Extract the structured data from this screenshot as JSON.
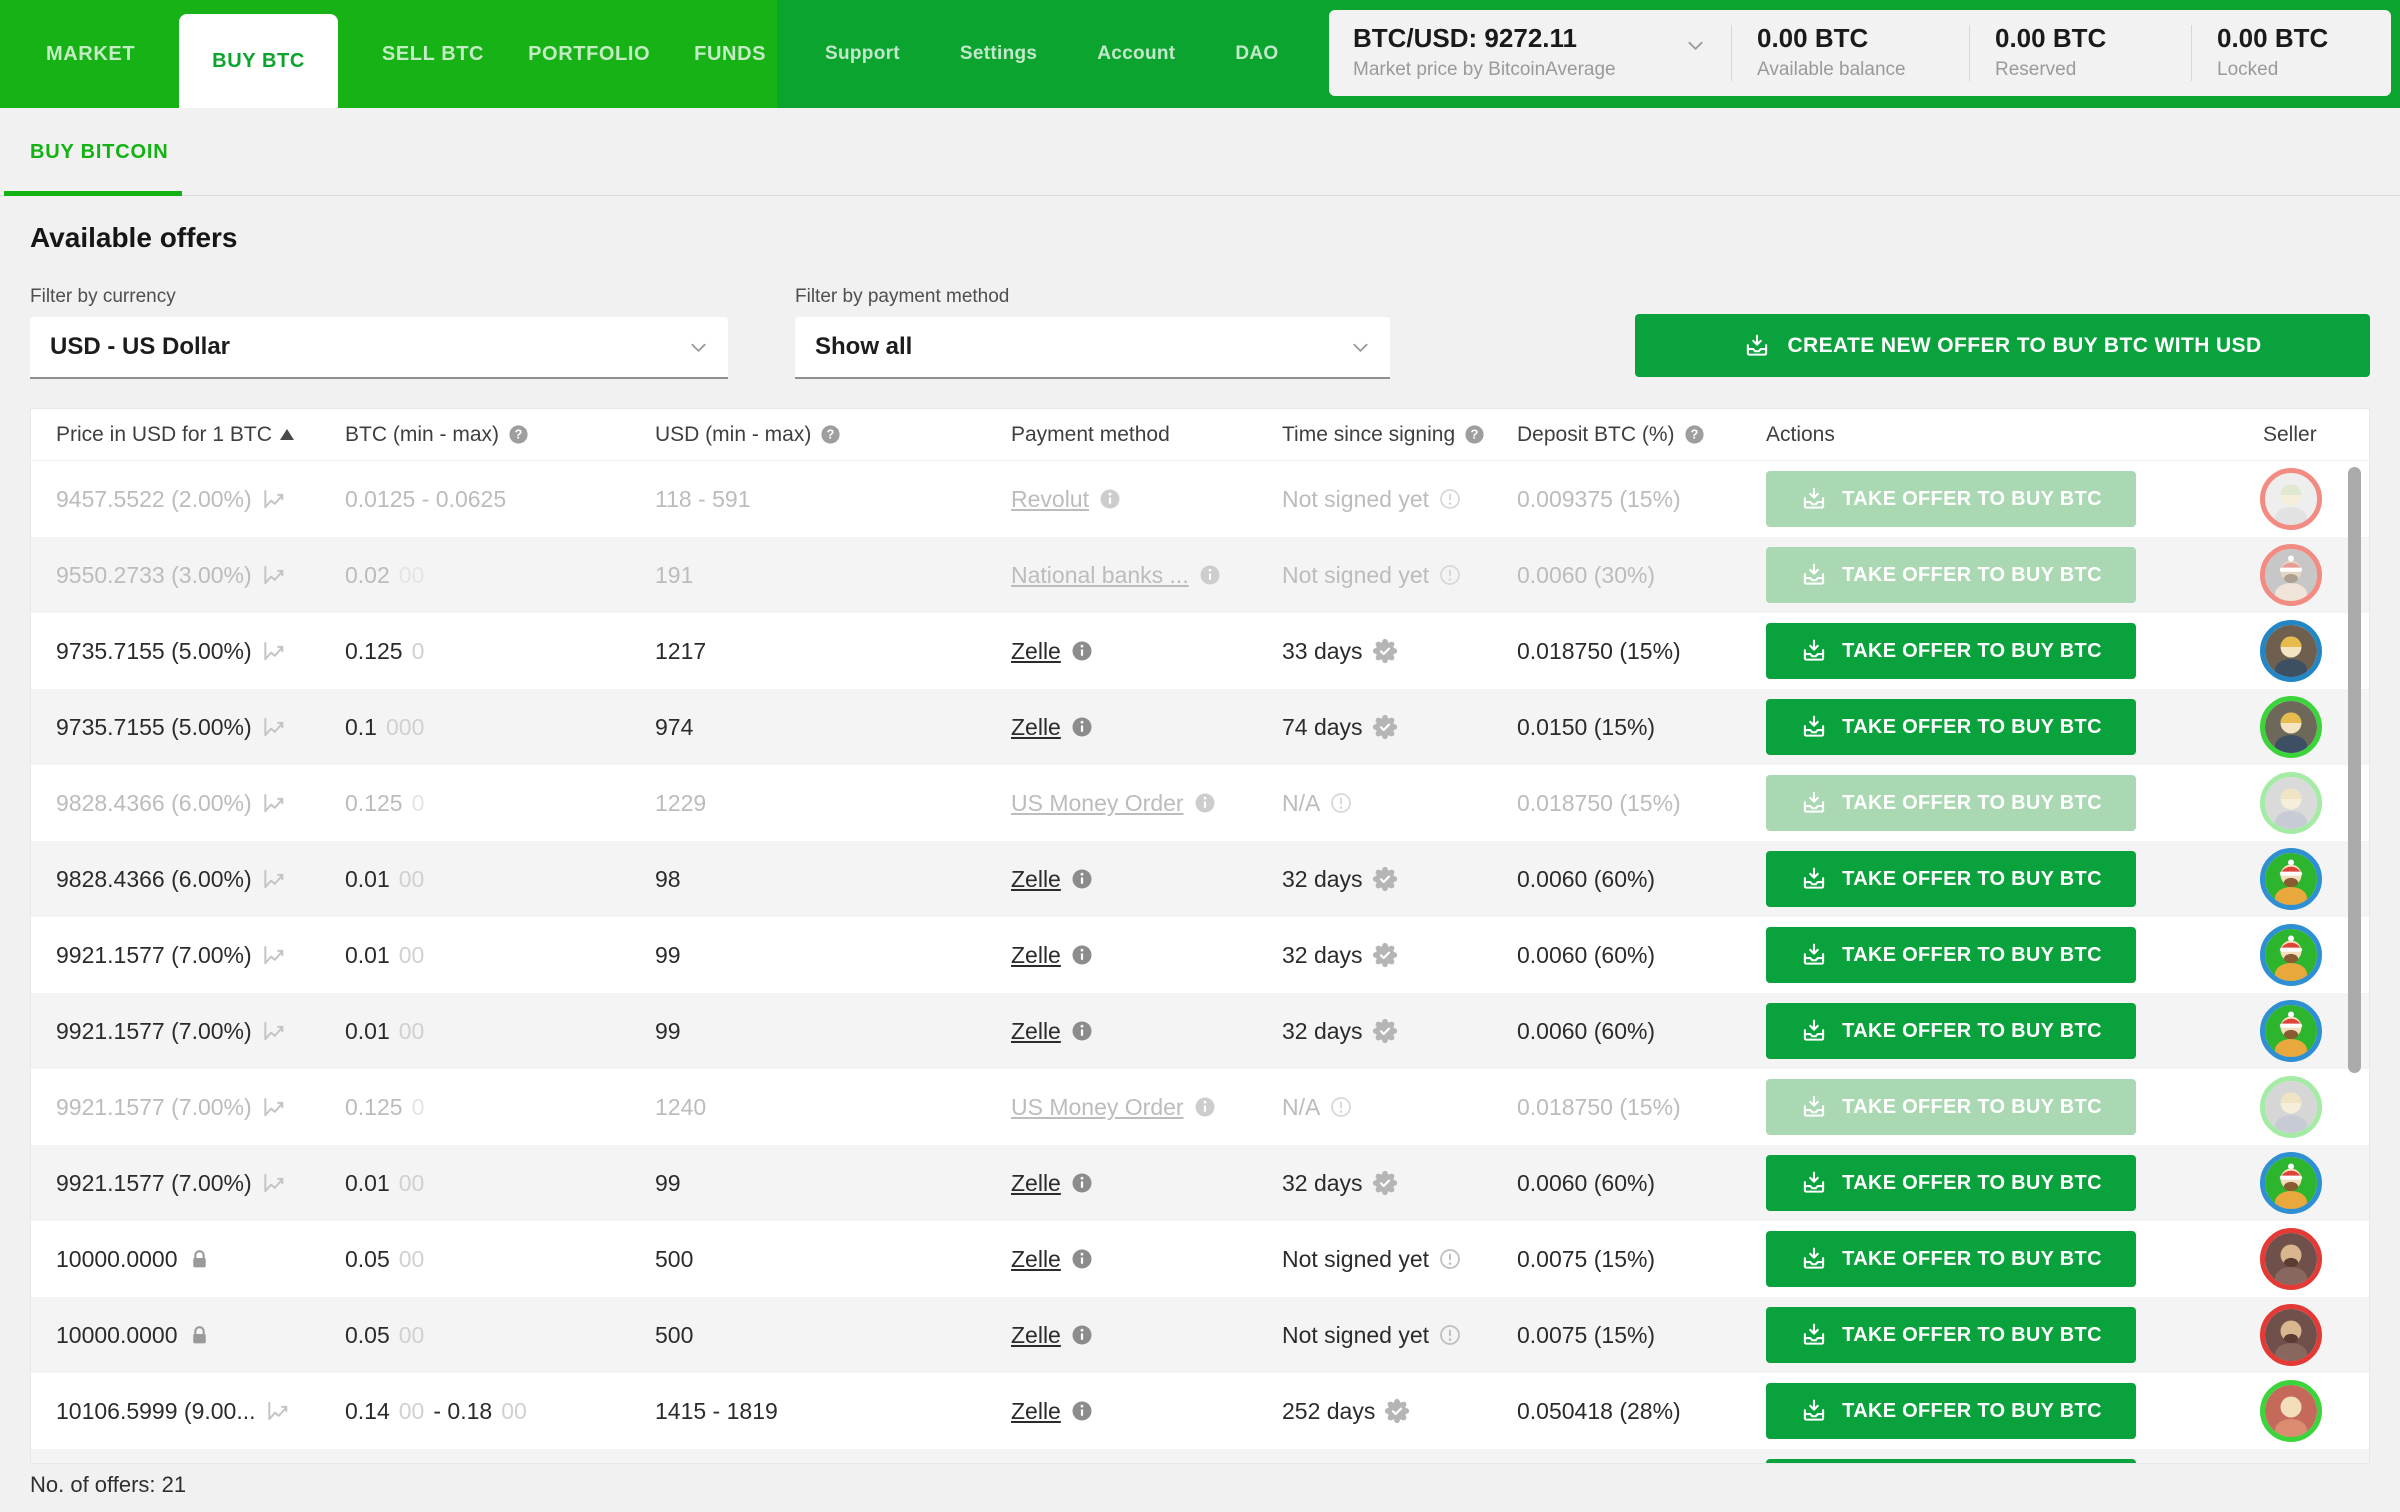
{
  "colors": {
    "nav_left": "#16b216",
    "nav_right": "#0aa42e",
    "accent_green": "#12b212",
    "button_green": "#0aa23c",
    "button_disabled": "#aad8b2",
    "page_bg": "#f1f1f1"
  },
  "nav": {
    "left_items": [
      {
        "label": "MARKET",
        "active": false
      },
      {
        "label": "BUY BTC",
        "active": true
      },
      {
        "label": "SELL BTC",
        "active": false
      },
      {
        "label": "PORTFOLIO",
        "active": false
      },
      {
        "label": "FUNDS",
        "active": false
      }
    ],
    "right_items": [
      "Support",
      "Settings",
      "Account",
      "DAO"
    ]
  },
  "ticker": {
    "pair": "BTC/USD: 9272.11",
    "subtitle": "Market price by BitcoinAverage",
    "balances": [
      {
        "value": "0.00 BTC",
        "label": "Available balance"
      },
      {
        "value": "0.00 BTC",
        "label": "Reserved"
      },
      {
        "value": "0.00 BTC",
        "label": "Locked"
      }
    ]
  },
  "subtab": {
    "label": "BUY BITCOIN"
  },
  "main": {
    "title": "Available offers",
    "currency_filter": {
      "label": "Filter by currency",
      "value": "USD  -  US Dollar"
    },
    "payment_filter": {
      "label": "Filter by payment method",
      "value": "Show all"
    },
    "create_button": "CREATE NEW OFFER TO BUY BTC WITH USD",
    "footer": "No. of offers: 21"
  },
  "table": {
    "headers": {
      "price": "Price in USD for 1 BTC",
      "btc": "BTC (min - max)",
      "usd": "USD (min - max)",
      "payment": "Payment method",
      "time": "Time since signing",
      "deposit": "Deposit BTC (%)",
      "actions": "Actions",
      "seller": "Seller"
    },
    "take_offer_label": "TAKE OFFER TO BUY BTC",
    "icon_names": {
      "chart": "price-chart-icon",
      "lock": "fixed-price-lock-icon",
      "signed": "signed-badge-icon",
      "unsigned": "not-signed-alert-icon",
      "info": "info-icon",
      "question": "help-icon",
      "tray": "take-offer-icon",
      "chevron": "chevron-down-icon",
      "sort": "sort-ascending-icon"
    },
    "offers": [
      {
        "price": "9457.5522 (2.00%)",
        "price_icon": "chart",
        "btc_parts": [
          [
            "0.0125 - 0.0625",
            false
          ]
        ],
        "usd": "118 - 591",
        "payment": "Revolut",
        "time": "Not signed yet",
        "time_icon": "unsigned",
        "deposit": "0.009375 (15%)",
        "faded": true,
        "avatar": {
          "ring": "#f28b82",
          "bg": "#eeeeee",
          "skin": "#f6eedb",
          "shirt": "#e2e2e2",
          "hair": "#dfe8d0"
        }
      },
      {
        "price": "9550.2733 (3.00%)",
        "price_icon": "chart",
        "btc_parts": [
          [
            "0.02",
            false
          ],
          [
            "00",
            true
          ]
        ],
        "usd": "191",
        "payment": "National banks ...",
        "time": "Not signed yet",
        "time_icon": "unsigned",
        "deposit": "0.0060 (30%)",
        "faded": true,
        "avatar": {
          "ring": "#f28b82",
          "bg": "#c7c7c7",
          "skin": "#e3d6c4",
          "shirt": "#efe3da",
          "hat": "#ea9b94",
          "beard": "#ada091"
        }
      },
      {
        "price": "9735.7155 (5.00%)",
        "price_icon": "chart",
        "btc_parts": [
          [
            "0.125",
            false
          ],
          [
            "0",
            true
          ]
        ],
        "usd": "1217",
        "payment": "Zelle",
        "time": "33 days",
        "time_icon": "signed",
        "deposit": "0.018750 (15%)",
        "faded": false,
        "avatar": {
          "ring": "#2286c5",
          "bg": "#6e5f4e",
          "skin": "#f3e4c2",
          "shirt": "#3c4f63",
          "hair": "#e7bb4e"
        }
      },
      {
        "price": "9735.7155 (5.00%)",
        "price_icon": "chart",
        "btc_parts": [
          [
            "0.1",
            false
          ],
          [
            "000",
            true
          ]
        ],
        "usd": "974",
        "payment": "Zelle",
        "time": "74 days",
        "time_icon": "signed",
        "deposit": "0.0150 (15%)",
        "faded": false,
        "avatar": {
          "ring": "#3bd43b",
          "bg": "#6d685a",
          "skin": "#f3e4c2",
          "shirt": "#3c4f63",
          "hair": "#e7bb4e"
        }
      },
      {
        "price": "9828.4366 (6.00%)",
        "price_icon": "chart",
        "btc_parts": [
          [
            "0.125",
            false
          ],
          [
            "0",
            true
          ]
        ],
        "usd": "1229",
        "payment": "US Money Order",
        "time": "N/A",
        "time_icon": "unsigned",
        "deposit": "0.018750 (15%)",
        "faded": true,
        "avatar": {
          "ring": "#a5eba5",
          "bg": "#dadada",
          "skin": "#f6eedb",
          "shirt": "#c7cbd3",
          "hair": "#efe4c4"
        }
      },
      {
        "price": "9828.4366 (6.00%)",
        "price_icon": "chart",
        "btc_parts": [
          [
            "0.01",
            false
          ],
          [
            "00",
            true
          ]
        ],
        "usd": "98",
        "payment": "Zelle",
        "time": "32 days",
        "time_icon": "signed",
        "deposit": "0.0060 (60%)",
        "faded": false,
        "avatar": {
          "ring": "#2e8fd2",
          "bg": "#2db52d",
          "skin": "#f2debc",
          "shirt": "#e9a83c",
          "hat": "#df4337",
          "beard": "#8a5a33"
        }
      },
      {
        "price": "9921.1577 (7.00%)",
        "price_icon": "chart",
        "btc_parts": [
          [
            "0.01",
            false
          ],
          [
            "00",
            true
          ]
        ],
        "usd": "99",
        "payment": "Zelle",
        "time": "32 days",
        "time_icon": "signed",
        "deposit": "0.0060 (60%)",
        "faded": false,
        "avatar": {
          "ring": "#2e8fd2",
          "bg": "#2db52d",
          "skin": "#f2debc",
          "shirt": "#e9a83c",
          "hat": "#df4337",
          "beard": "#8a5a33"
        }
      },
      {
        "price": "9921.1577 (7.00%)",
        "price_icon": "chart",
        "btc_parts": [
          [
            "0.01",
            false
          ],
          [
            "00",
            true
          ]
        ],
        "usd": "99",
        "payment": "Zelle",
        "time": "32 days",
        "time_icon": "signed",
        "deposit": "0.0060 (60%)",
        "faded": false,
        "avatar": {
          "ring": "#2e8fd2",
          "bg": "#2db52d",
          "skin": "#f2debc",
          "shirt": "#e9a83c",
          "hat": "#df4337",
          "beard": "#8a5a33"
        }
      },
      {
        "price": "9921.1577 (7.00%)",
        "price_icon": "chart",
        "btc_parts": [
          [
            "0.125",
            false
          ],
          [
            "0",
            true
          ]
        ],
        "usd": "1240",
        "payment": "US Money Order",
        "time": "N/A",
        "time_icon": "unsigned",
        "deposit": "0.018750 (15%)",
        "faded": true,
        "avatar": {
          "ring": "#a5eba5",
          "bg": "#d6d6d6",
          "skin": "#f6eedb",
          "shirt": "#c7cbd3",
          "hair": "#efe4c4"
        }
      },
      {
        "price": "9921.1577 (7.00%)",
        "price_icon": "chart",
        "btc_parts": [
          [
            "0.01",
            false
          ],
          [
            "00",
            true
          ]
        ],
        "usd": "99",
        "payment": "Zelle",
        "time": "32 days",
        "time_icon": "signed",
        "deposit": "0.0060 (60%)",
        "faded": false,
        "avatar": {
          "ring": "#2e8fd2",
          "bg": "#2db52d",
          "skin": "#f2debc",
          "shirt": "#e9a83c",
          "hat": "#df4337",
          "beard": "#8a5a33"
        }
      },
      {
        "price": "10000.0000",
        "price_icon": "lock",
        "btc_parts": [
          [
            "0.05",
            false
          ],
          [
            "00",
            true
          ]
        ],
        "usd": "500",
        "payment": "Zelle",
        "time": "Not signed yet",
        "time_icon": "unsigned",
        "deposit": "0.0075 (15%)",
        "faded": false,
        "avatar": {
          "ring": "#e43a35",
          "bg": "#6f504b",
          "skin": "#d9b590",
          "shirt": "#87675e",
          "beard": "#5c3c32"
        }
      },
      {
        "price": "10000.0000",
        "price_icon": "lock",
        "btc_parts": [
          [
            "0.05",
            false
          ],
          [
            "00",
            true
          ]
        ],
        "usd": "500",
        "payment": "Zelle",
        "time": "Not signed yet",
        "time_icon": "unsigned",
        "deposit": "0.0075 (15%)",
        "faded": false,
        "avatar": {
          "ring": "#e43a35",
          "bg": "#6f504b",
          "skin": "#d9b590",
          "shirt": "#87675e",
          "beard": "#5c3c32"
        }
      },
      {
        "price": "10106.5999 (9.00...",
        "price_icon": "chart",
        "btc_parts": [
          [
            "0.14",
            false
          ],
          [
            "00",
            true
          ],
          [
            " - 0.18",
            false
          ],
          [
            "00",
            true
          ]
        ],
        "usd": "1415 - 1819",
        "payment": "Zelle",
        "time": "252 days",
        "time_icon": "signed",
        "deposit": "0.050418 (28%)",
        "faded": false,
        "avatar": {
          "ring": "#3bd43b",
          "bg": "#c5695b",
          "skin": "#f3debc",
          "shirt": "#da8b70"
        }
      }
    ],
    "partial_row_visible": true
  }
}
